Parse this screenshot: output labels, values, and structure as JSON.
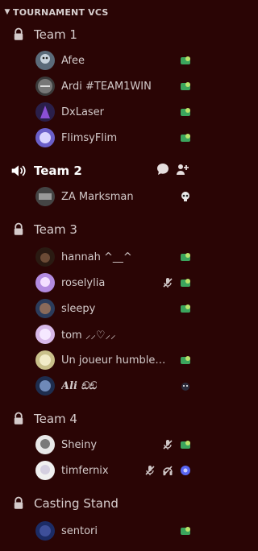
{
  "category": {
    "title": "TOURNAMENT VCS"
  },
  "channels": [
    {
      "name": "Team 1",
      "locked": true,
      "active": false
    },
    {
      "name": "Team 2",
      "locked": false,
      "active": true
    },
    {
      "name": "Team 3",
      "locked": true,
      "active": false
    },
    {
      "name": "Team 4",
      "locked": true,
      "active": false
    },
    {
      "name": "Casting Stand",
      "locked": true,
      "active": false
    }
  ],
  "users": [
    {
      "name": "Afee"
    },
    {
      "name": "Ardi #TEAM1WIN"
    },
    {
      "name": "DxLaser"
    },
    {
      "name": "FlimsyFlim"
    },
    {
      "name": "ZA Marksman"
    },
    {
      "name": "hannah ^__^"
    },
    {
      "name": "roselylia"
    },
    {
      "name": "sleepy"
    },
    {
      "name": "tom ⸝⸝♡⸝⸝"
    },
    {
      "name": "Un joueur humble [..."
    },
    {
      "name": "𝑨𝒍𝒊 ඞඞ"
    },
    {
      "name": "Sheiny"
    },
    {
      "name": "timfernix"
    },
    {
      "name": "sentori"
    }
  ],
  "colors": {
    "background": "#2a0505",
    "activity_badge": "#3ba55d",
    "purple_badge": "#5865f2"
  }
}
